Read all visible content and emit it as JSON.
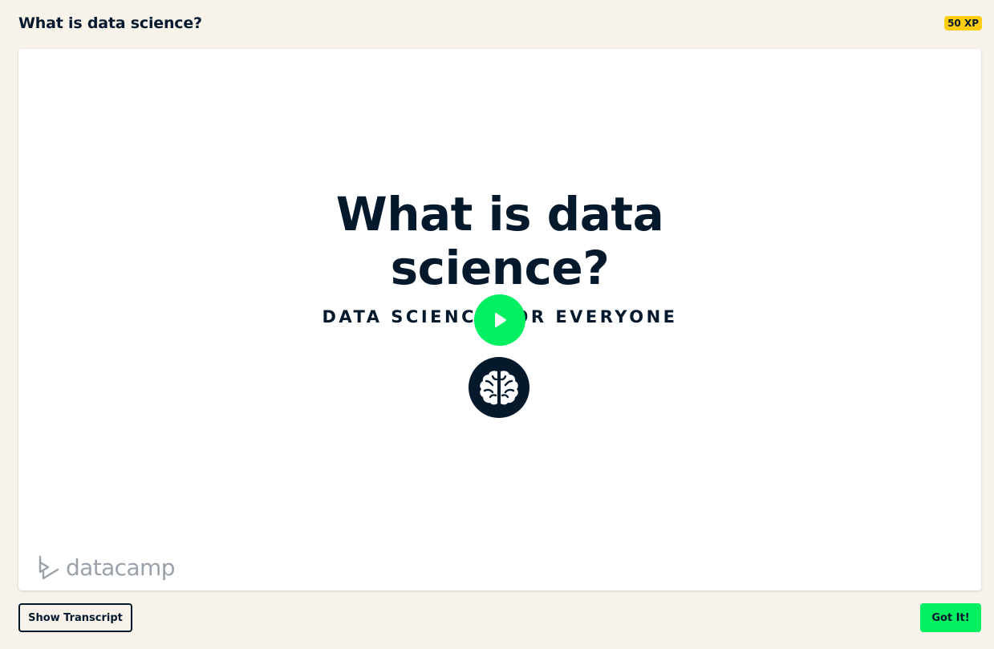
{
  "header": {
    "title": "What is data science?",
    "xp_badge": "50 XP"
  },
  "video": {
    "slide_title_line1": "What is data",
    "slide_title_line2": "science?",
    "slide_subtitle": "DATA SCIENCE FOR EVERYONE",
    "play_icon": "play-icon",
    "course_icon": "brain-icon",
    "logo_text": "datacamp"
  },
  "footer": {
    "transcript_button": "Show Transcript",
    "got_it_button": "Got It!"
  },
  "colors": {
    "background": "#f7f3eb",
    "navy": "#05192d",
    "green": "#03ef62",
    "yellow": "#fcce0d",
    "logo_gray": "#9aa1a9"
  }
}
